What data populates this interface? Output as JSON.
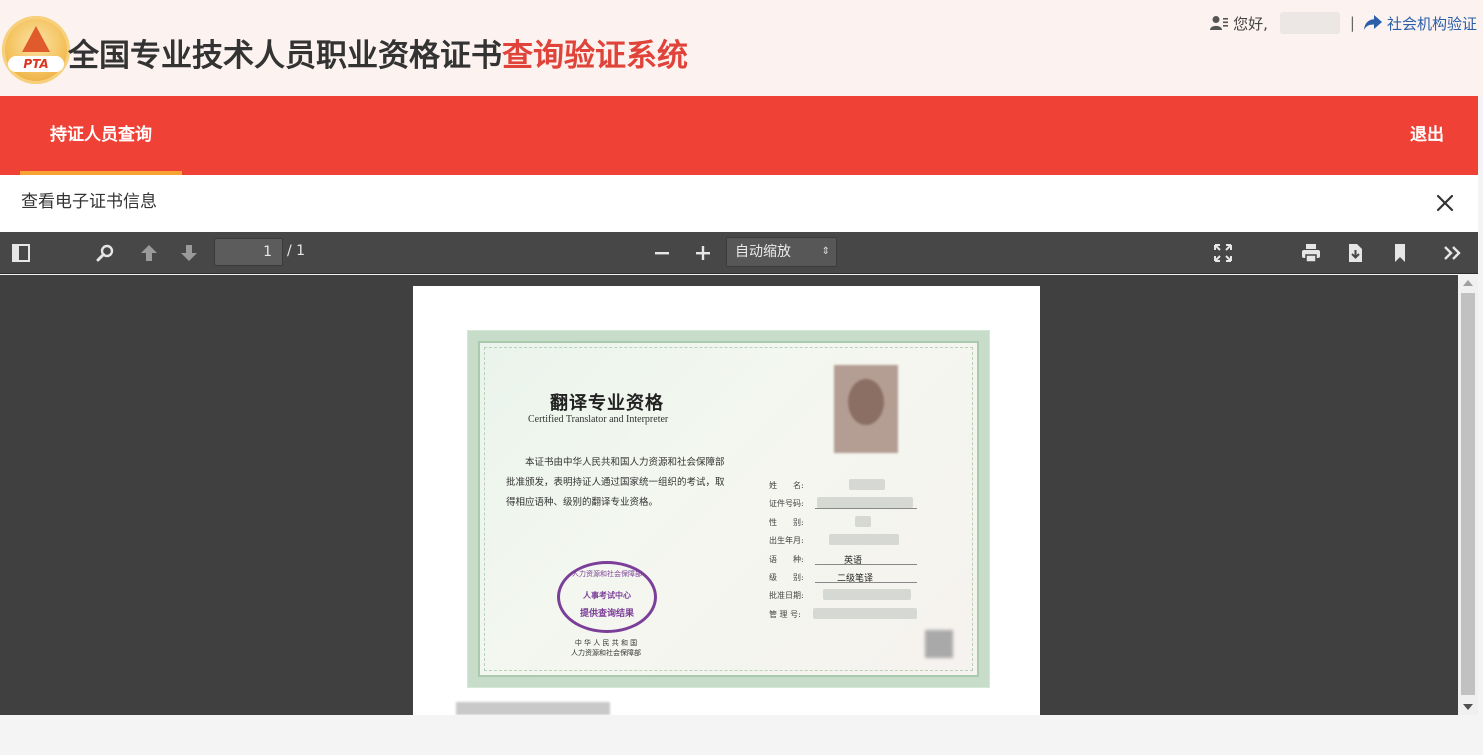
{
  "header": {
    "logo_text": "PTA",
    "title_black": "全国专业技术人员职业资格证书",
    "title_red": "查询验证系统",
    "greeting": "您好,",
    "separator": "|",
    "org_link": "社会机构验证"
  },
  "nav": {
    "active_tab": "持证人员查询",
    "logout": "退出"
  },
  "panel": {
    "title": "查看电子证书信息"
  },
  "viewer": {
    "page_current": "1",
    "page_total": "/ 1",
    "zoom": "自动缩放"
  },
  "certificate": {
    "title": "翻译专业资格",
    "subtitle": "Certified Translator and Interpreter",
    "body": "本证书由中华人民共和国人力资源和社会保障部批准颁发，表明持证人通过国家统一组织的考试，取得相应语种、级别的翻译专业资格。",
    "fields": [
      {
        "label": "姓　　名:",
        "value": ""
      },
      {
        "label": "证件号码:",
        "value": ""
      },
      {
        "label": "性　　别:",
        "value": ""
      },
      {
        "label": "出生年月:",
        "value": ""
      },
      {
        "label": "语　　种:",
        "value": "英语"
      },
      {
        "label": "级　　别:",
        "value": "二级笔译"
      },
      {
        "label": "批准日期:",
        "value": ""
      },
      {
        "label": "管 理 号:",
        "value": ""
      }
    ],
    "seal_line1": "人力资源和社会保障部",
    "seal_line2": "人事考试中心",
    "seal_line3": "提供查询结果",
    "issuer_line1": "中 华 人 民 共 和 国",
    "issuer_line2": "人力资源和社会保障部"
  },
  "colors": {
    "nav_red": "#ef4136",
    "tab_underline": "#f7a434",
    "title_red": "#e04339",
    "link_blue": "#2a5ea8",
    "viewer_toolbar": "#474747",
    "viewer_bg": "#404040"
  }
}
